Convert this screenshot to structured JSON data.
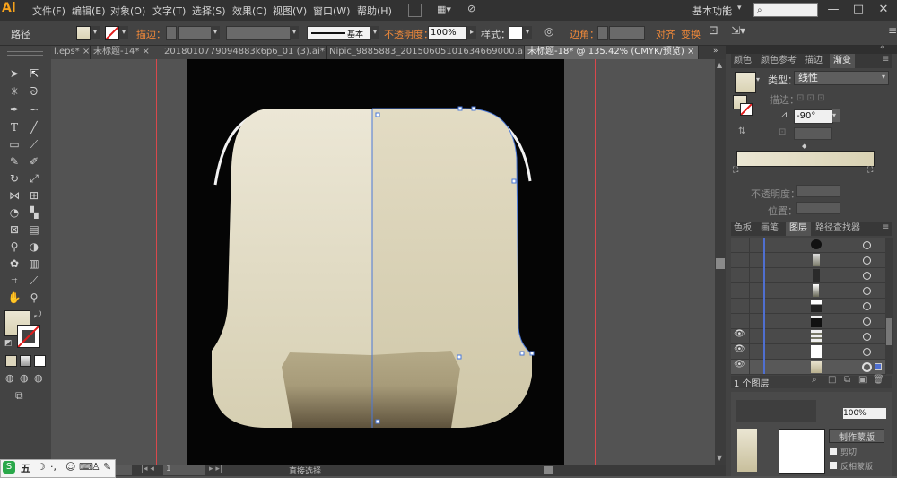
{
  "menubar": {
    "logo": "Ai",
    "items": [
      "文件(F)",
      "编辑(E)",
      "对象(O)",
      "文字(T)",
      "选择(S)",
      "效果(C)",
      "视图(V)",
      "窗口(W)",
      "帮助(H)"
    ],
    "workspace": "基本功能",
    "window_buttons": [
      "—",
      "□",
      "✕"
    ]
  },
  "control": {
    "object_type": "路径",
    "stroke_label": "描边：",
    "stroke_style": "基本",
    "opacity_label": "不透明度：",
    "opacity_value": "100%",
    "style_label": "样式：",
    "corner_label": "边角：",
    "align_label": "对齐",
    "transform_label": "变换"
  },
  "tabs": [
    {
      "label": "l.eps*",
      "active": false
    },
    {
      "label": "未标题-14*",
      "active": false
    },
    {
      "label": "2018010779094883k6p6_01 (3).ai*",
      "active": false
    },
    {
      "label": "Nipic_9885883_20150605101634669000.ai*",
      "active": false
    },
    {
      "label": "未标题-18* @ 135.42% (CMYK/预览)",
      "active": true
    }
  ],
  "gradient_panel": {
    "tabs": [
      "颜色",
      "颜色参考",
      "描边",
      "渐变"
    ],
    "active_tab": "渐变",
    "type_label": "类型：",
    "type_value": "线性",
    "stroke_label": "描边：",
    "angle_value": "-90°",
    "opacity_label": "不透明度：",
    "location_label": "位置：",
    "start_color": "#d9d2b3",
    "end_color": "#ebe6d3"
  },
  "layers_panel": {
    "tabs": [
      "色板",
      "画笔",
      "图层",
      "路径查找器"
    ],
    "active_tab": "图层",
    "footer_count": "1 个图层",
    "rows": [
      {
        "visible": false,
        "thumb": "ellipse-dark"
      },
      {
        "visible": false,
        "thumb": "bottle"
      },
      {
        "visible": false,
        "thumb": "dark-block"
      },
      {
        "visible": false,
        "thumb": "bottle-small"
      },
      {
        "visible": false,
        "thumb": "bar"
      },
      {
        "visible": false,
        "thumb": "bar-dark"
      },
      {
        "visible": true,
        "thumb": "stripes"
      },
      {
        "visible": true,
        "thumb": "blank"
      },
      {
        "visible": true,
        "thumb": "gradient"
      }
    ]
  },
  "transparency_panel": {
    "opacity_value": "100%",
    "make_mask": "制作蒙版",
    "clip_label": "剪切",
    "invert_label": "反相蒙版"
  },
  "status": {
    "zoom": "135.42%",
    "page": "1",
    "tool_label": "直接选择"
  },
  "ime": {
    "label": "五"
  },
  "colors": {
    "app_bg": "#535353",
    "artboard": "#050505",
    "guide": "#d9484c",
    "cream_top": "#ece7d6",
    "cream_bottom": "#d6cfb2",
    "dark_base_top": "#b5aa88",
    "dark_base_bottom": "#5e523c",
    "selection": "#4a78d8"
  }
}
